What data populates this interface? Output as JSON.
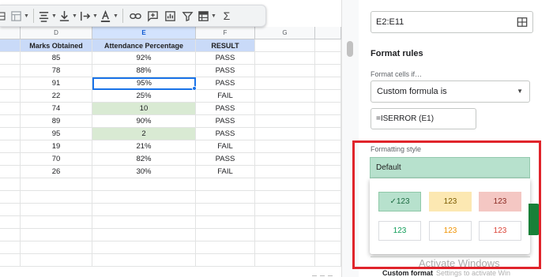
{
  "toolbar": {
    "items": [
      "table-icon",
      "filter-views-icon",
      "align-icon",
      "valign-icon",
      "text-direction-icon",
      "text-color-icon",
      "link-icon",
      "comment-icon",
      "chart-icon",
      "filter-icon",
      "view-icon",
      "functions-icon"
    ]
  },
  "columns": {
    "D": "D",
    "E": "E",
    "F": "F",
    "G": "G"
  },
  "table": {
    "headers": [
      "Marks Obtained",
      "Attendance Percentage",
      "RESULT"
    ],
    "rows": [
      {
        "marks": "85",
        "attendance": "92%",
        "result": "PASS"
      },
      {
        "marks": "78",
        "attendance": "88%",
        "result": "PASS"
      },
      {
        "marks": "91",
        "attendance": "95%",
        "result": "PASS"
      },
      {
        "marks": "22",
        "attendance": "25%",
        "result": "FAIL"
      },
      {
        "marks": "74",
        "attendance": "10",
        "result": "PASS"
      },
      {
        "marks": "89",
        "attendance": "90%",
        "result": "PASS"
      },
      {
        "marks": "95",
        "attendance": "2",
        "result": "PASS"
      },
      {
        "marks": "19",
        "attendance": "21%",
        "result": "FAIL"
      },
      {
        "marks": "70",
        "attendance": "82%",
        "result": "PASS"
      },
      {
        "marks": "26",
        "attendance": "30%",
        "result": "FAIL"
      }
    ],
    "highlight_color": "#d9ead3",
    "header_color": "#c9daf8"
  },
  "panel": {
    "range_value": "E2:E11",
    "format_rules_title": "Format rules",
    "format_cells_if_label": "Format cells if…",
    "condition_value": "Custom formula is",
    "formula_value": "=ISERROR (E1)",
    "formatting_style_label": "Formatting style",
    "style_selected": "Default",
    "presets": [
      {
        "label": "✓123",
        "bg": "#b7e1cd",
        "color": "#1e6b43",
        "border": "#8fc9a8"
      },
      {
        "label": "123",
        "bg": "#fce8b2",
        "color": "#7a5a00",
        "border": "#fce8b2"
      },
      {
        "label": "123",
        "bg": "#f4c7c3",
        "color": "#8a2a22",
        "border": "#f4c7c3"
      },
      {
        "label": "123",
        "bg": "#ffffff",
        "color": "#0f9d58",
        "border": "#dadce0"
      },
      {
        "label": "123",
        "bg": "#ffffff",
        "color": "#f09300",
        "border": "#dadce0"
      },
      {
        "label": "123",
        "bg": "#ffffff",
        "color": "#db4437",
        "border": "#dadce0"
      }
    ],
    "custom_format_label": "Custom format",
    "watermark_line2": "Settings to activate Win"
  },
  "watermark": "Activate Windows",
  "colors": {
    "accent_red": "#e0242b",
    "selection_blue": "#1a73e8",
    "done_green": "#188038"
  }
}
